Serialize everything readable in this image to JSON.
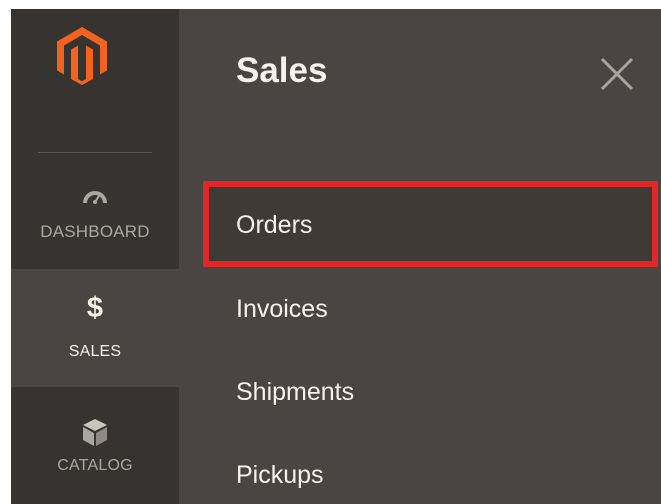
{
  "rail": {
    "items": [
      {
        "label": "DASHBOARD",
        "icon": "speedometer-icon"
      },
      {
        "label": "SALES",
        "icon": "dollar-icon",
        "active": true
      },
      {
        "label": "CATALOG",
        "icon": "box-icon"
      }
    ]
  },
  "submenu": {
    "title": "Sales",
    "items": [
      {
        "label": "Orders",
        "highlighted": true
      },
      {
        "label": "Invoices"
      },
      {
        "label": "Shipments"
      },
      {
        "label": "Pickups"
      }
    ]
  },
  "colors": {
    "rail_bg": "#373330",
    "panel_bg": "#4a4542",
    "highlight_border": "#e22626",
    "logo": "#f26322"
  }
}
